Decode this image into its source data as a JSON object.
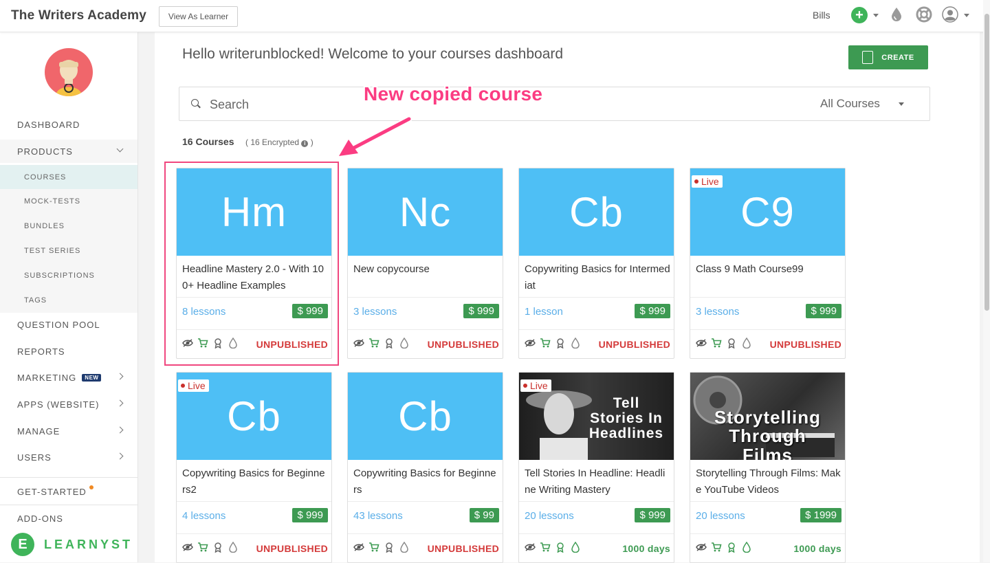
{
  "topbar": {
    "brand": "The Writers Academy",
    "view_as_learner": "View As Learner",
    "account": "Bills",
    "icons": [
      "plus-icon",
      "droplet-icon",
      "help-lifebuoy-icon",
      "user-avatar-icon"
    ]
  },
  "sidebar": {
    "items": [
      {
        "label": "DASHBOARD"
      },
      {
        "label": "PRODUCTS"
      },
      {
        "label": "COURSES"
      },
      {
        "label": "MOCK-TESTS"
      },
      {
        "label": "BUNDLES"
      },
      {
        "label": "TEST SERIES"
      },
      {
        "label": "SUBSCRIPTIONS"
      },
      {
        "label": "TAGS"
      },
      {
        "label": "QUESTION POOL"
      },
      {
        "label": "REPORTS"
      },
      {
        "label": "MARKETING",
        "badge": "NEW"
      },
      {
        "label": "APPS (WEBSITE)"
      },
      {
        "label": "MANAGE"
      },
      {
        "label": "USERS"
      },
      {
        "label": "GET-STARTED"
      },
      {
        "label": "ADD-ONS"
      }
    ],
    "footer_logo": "LEARNYST",
    "footer_logo_letter": "E"
  },
  "main": {
    "welcome": "Hello writerunblocked! Welcome to your courses dashboard",
    "create_label": "CREATE",
    "search_placeholder": "Search",
    "filter_label": "All Courses",
    "count": "16 Courses",
    "encrypted": "( 16 Encrypted",
    "encrypted_close": ")",
    "annotation": "New copied course"
  },
  "courses": [
    {
      "initials": "Hm",
      "title": "Headline Mastery 2.0 - With 100+ Headline Examples",
      "lessons": "8 lessons",
      "price": "$ 999",
      "status": "UNPUBLISHED",
      "live": false
    },
    {
      "initials": "Nc",
      "title": "New copycourse",
      "lessons": "3 lessons",
      "price": "$ 999",
      "status": "UNPUBLISHED",
      "live": false
    },
    {
      "initials": "Cb",
      "title": "Copywriting Basics for Intermediat",
      "lessons": "1 lesson",
      "price": "$ 999",
      "status": "UNPUBLISHED",
      "live": false
    },
    {
      "initials": "C9",
      "title": "Class 9 Math Course99",
      "lessons": "3 lessons",
      "price": "$ 999",
      "status": "UNPUBLISHED",
      "live": true,
      "live_label": "Live"
    },
    {
      "initials": "Cb",
      "title": "Copywriting Basics for Beginners2",
      "lessons": "4 lessons",
      "price": "$ 999",
      "status": "UNPUBLISHED",
      "live": true,
      "live_label": "Live"
    },
    {
      "initials": "Cb",
      "title": "Copywriting Basics for Beginners",
      "lessons": "43 lessons",
      "price": "$ 99",
      "status": "UNPUBLISHED",
      "live": false
    },
    {
      "image_text": "Tell Stories In Headlines",
      "title": "Tell Stories In Headline: Headline Writing Mastery",
      "lessons": "20 lessons",
      "price": "$ 999",
      "status": "1000 days",
      "live": true,
      "live_label": "Live"
    },
    {
      "image_text": "Storytelling Through Films",
      "title": "Storytelling Through Films: Make YouTube Videos",
      "lessons": "20 lessons",
      "price": "$ 1999",
      "status": "1000 days",
      "live": false
    }
  ],
  "colors": {
    "accent_green": "#3d9a52",
    "thumb_blue": "#4ebff5",
    "unpublished_red": "#d43a3a",
    "annotation_pink": "#fb3c82"
  }
}
